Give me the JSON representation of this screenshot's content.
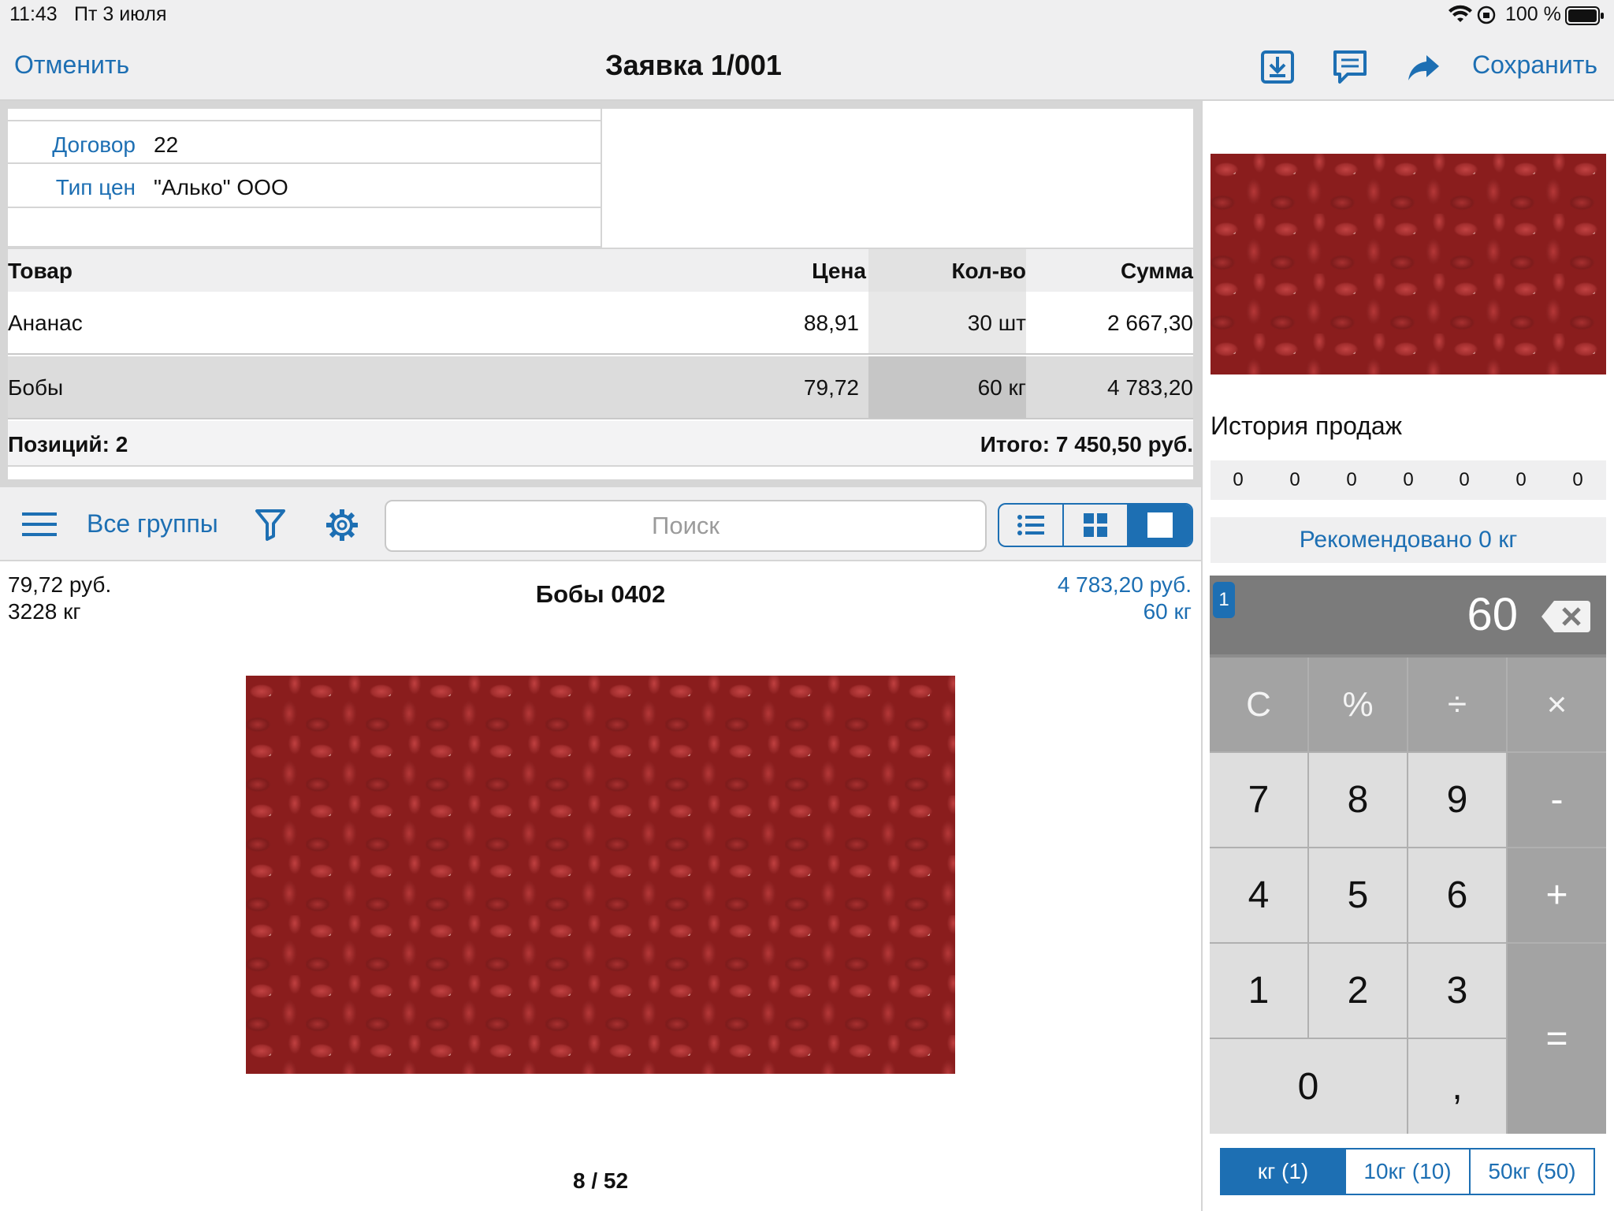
{
  "status_bar": {
    "time": "11:43",
    "date": "Пт 3 июля",
    "battery": "100 %"
  },
  "nav": {
    "cancel": "Отменить",
    "title": "Заявка 1/001",
    "save": "Сохранить"
  },
  "fields": [
    {
      "label": "Договор",
      "value": "22"
    },
    {
      "label": "Тип цен",
      "value": "\"Алько\" ООО"
    }
  ],
  "table": {
    "headers": {
      "product": "Товар",
      "price": "Цена",
      "qty": "Кол-во",
      "sum": "Сумма"
    },
    "rows": [
      {
        "product": "Ананас",
        "price": "88,91",
        "qty": "30 шт",
        "sum": "2 667,30"
      },
      {
        "product": "Бобы",
        "price": "79,72",
        "qty": "60 кг",
        "sum": "4 783,20"
      }
    ],
    "positions": "Позиций: 2",
    "total": "Итого: 7 450,50 руб."
  },
  "toolbar": {
    "groups": "Все группы",
    "search_placeholder": "Поиск"
  },
  "product": {
    "price": "79,72 руб.",
    "stock": "3228 кг",
    "name": "Бобы 0402",
    "sum": "4 783,20 руб.",
    "qty": "60 кг",
    "pager": "8 / 52"
  },
  "sales_history": {
    "title": "История продаж",
    "values": [
      "0",
      "0",
      "0",
      "0",
      "0",
      "0",
      "0"
    ]
  },
  "recommended": "Рекомендовано 0 кг",
  "calculator": {
    "badge": "1",
    "display": "60",
    "keys": {
      "c": "C",
      "pct": "%",
      "div": "÷",
      "mul": "×",
      "k7": "7",
      "k8": "8",
      "k9": "9",
      "minus": "-",
      "k4": "4",
      "k5": "5",
      "k6": "6",
      "plus": "+",
      "k1": "1",
      "k2": "2",
      "k3": "3",
      "eq": "=",
      "k0": "0",
      "comma": ","
    }
  },
  "units": [
    "кг (1)",
    "10кг (10)",
    "50кг (50)"
  ],
  "colors": {
    "accent": "#1d6fb3",
    "bar_bg": "#efeff0"
  }
}
